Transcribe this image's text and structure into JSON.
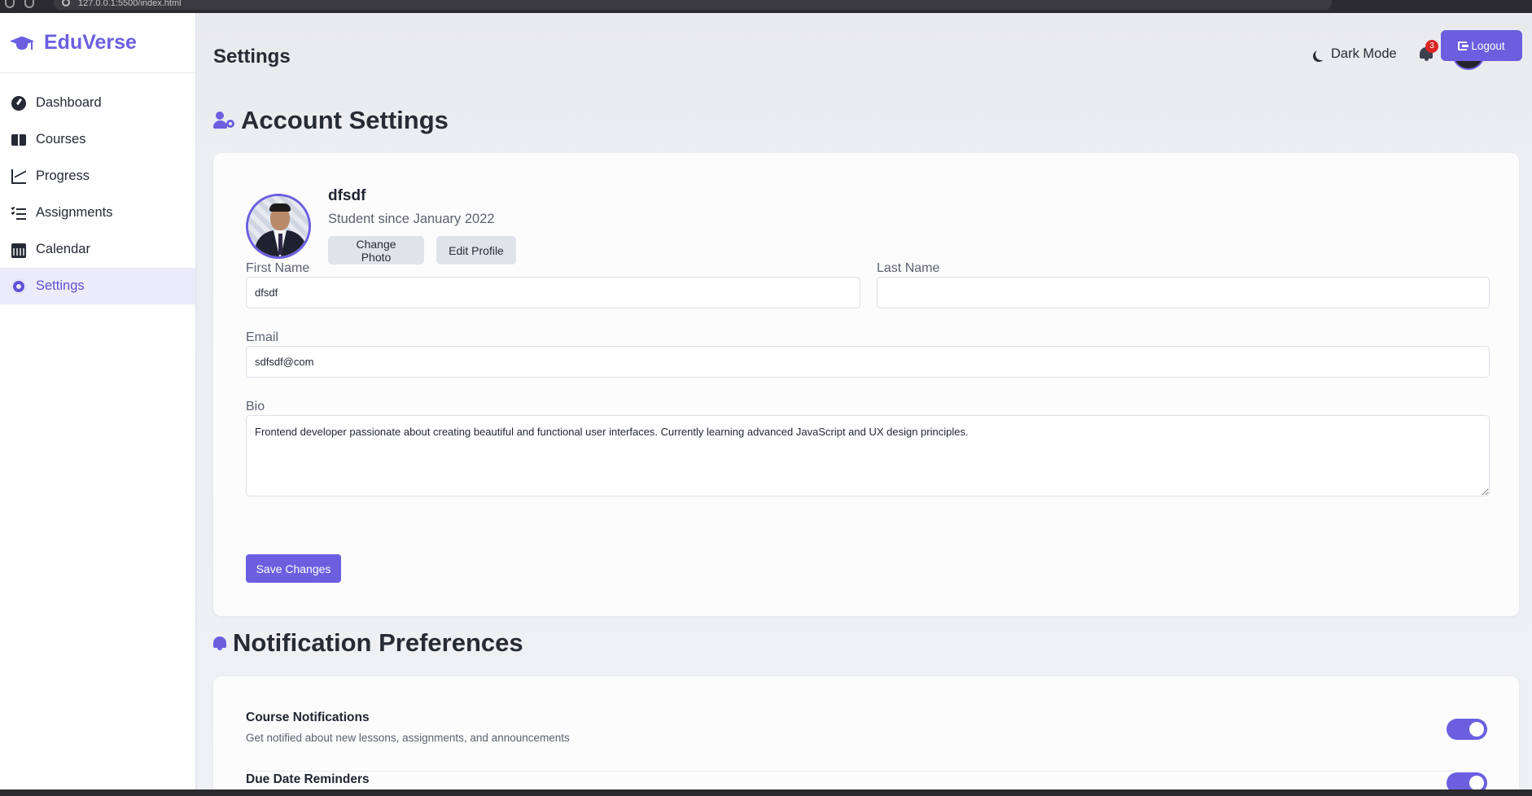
{
  "browser": {
    "url": "127.0.0.1:5500/index.html"
  },
  "brand": {
    "name": "EduVerse",
    "icon": "graduation-cap-icon",
    "color": "#6b5fe0"
  },
  "sidebar": {
    "items": [
      {
        "label": "Dashboard",
        "icon": "dashboard-icon",
        "active": false
      },
      {
        "label": "Courses",
        "icon": "book-open-icon",
        "active": false
      },
      {
        "label": "Progress",
        "icon": "line-chart-icon",
        "active": false
      },
      {
        "label": "Assignments",
        "icon": "tasks-icon",
        "active": false
      },
      {
        "label": "Calendar",
        "icon": "calendar-icon",
        "active": false
      },
      {
        "label": "Settings",
        "icon": "gear-icon",
        "active": true
      }
    ]
  },
  "topbar": {
    "title": "Settings",
    "dark_mode_label": "Dark Mode",
    "notification_count": "3",
    "logout_label": "Logout"
  },
  "account": {
    "section_title": "Account Settings",
    "profile": {
      "name": "dfsdf",
      "since": "Student since January 2022",
      "change_photo_label": "Change Photo",
      "edit_profile_label": "Edit Profile"
    },
    "fields": {
      "first_name_label": "First Name",
      "first_name_value": "dfsdf",
      "last_name_label": "Last Name",
      "last_name_value": "",
      "email_label": "Email",
      "email_value": "sdfsdf@com",
      "bio_label": "Bio",
      "bio_value": "Frontend developer passionate about creating beautiful and functional user interfaces. Currently learning advanced JavaScript and UX design principles."
    },
    "save_label": "Save Changes"
  },
  "notifications": {
    "section_title": "Notification Preferences",
    "prefs": [
      {
        "title": "Course Notifications",
        "description": "Get notified about new lessons, assignments, and announcements",
        "enabled": true
      },
      {
        "title": "Due Date Reminders",
        "description": "",
        "enabled": true
      }
    ]
  },
  "colors": {
    "accent": "#6b5fe0",
    "badge": "#dc2626",
    "active_nav_bg": "#ecebfa"
  }
}
